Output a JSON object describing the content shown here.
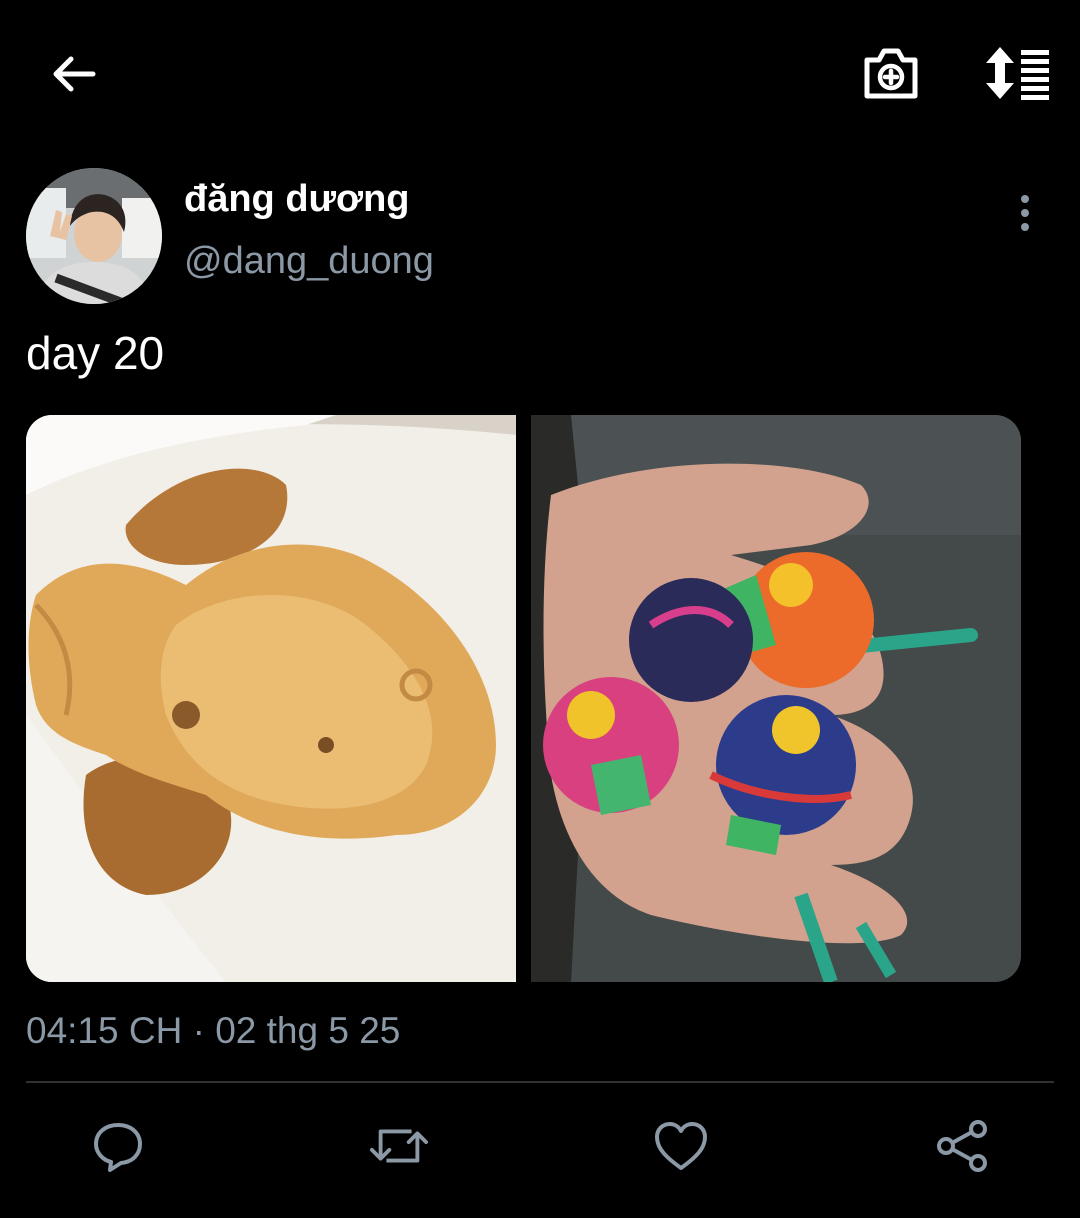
{
  "header": {
    "back_icon": "arrow-left-icon",
    "camera_icon": "camera-plus-icon",
    "sort_icon": "sort-list-icon"
  },
  "tweet": {
    "author": {
      "display_name": "đăng dương",
      "handle": "@dang_duong",
      "avatar_icon": "avatar-photo"
    },
    "text": "day 20",
    "media": [
      {
        "name": "taiyaki-photo"
      },
      {
        "name": "lollipops-photo"
      }
    ],
    "timestamp": "04:15 CH · 02 thg 5 25"
  },
  "actions": {
    "reply_icon": "reply-icon",
    "retweet_icon": "retweet-icon",
    "like_icon": "heart-icon",
    "share_icon": "share-icon"
  },
  "colors": {
    "background": "#000000",
    "text_primary": "#ffffff",
    "text_secondary": "#8b98a5",
    "divider": "#2f3336"
  }
}
